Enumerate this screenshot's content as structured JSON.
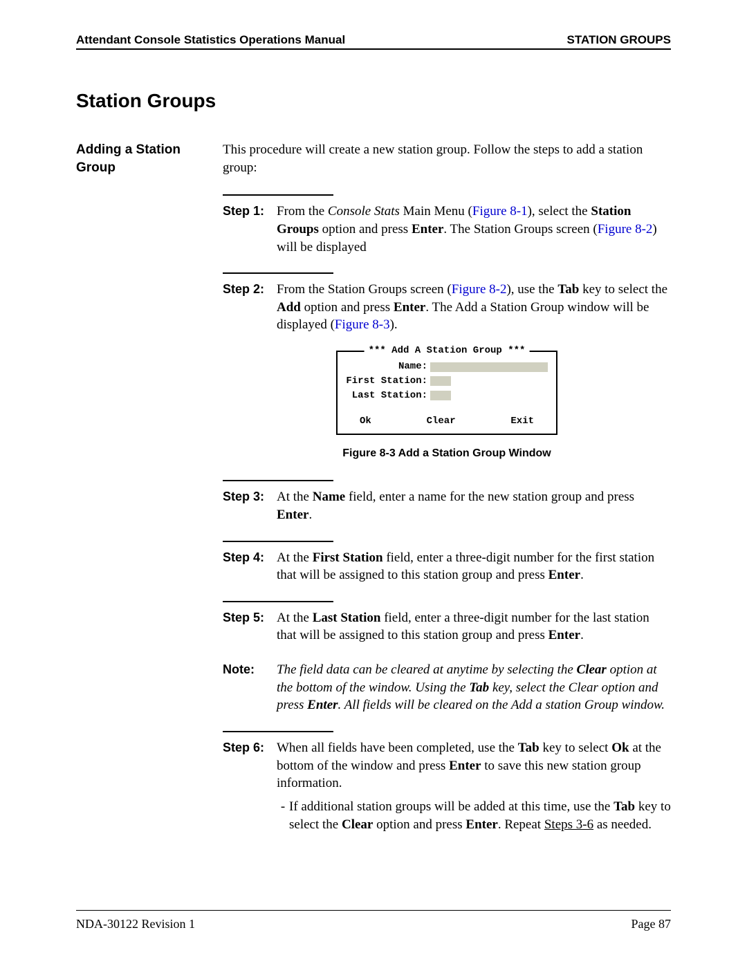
{
  "header": {
    "left": "Attendant Console Statistics Operations Manual",
    "right": "STATION GROUPS"
  },
  "section_title": "Station Groups",
  "side_heading": "Adding a Station Group",
  "intro": {
    "t1": "This procedure will create a new station group. Follow the steps to add a station group:"
  },
  "step1": {
    "label": "Step 1:",
    "t1": "From the ",
    "em1": "Console Stats",
    "t2": " Main Menu (",
    "ref1": "Figure 8-1",
    "t3": "), select the ",
    "b1": "Station Groups",
    "t4": " option and press ",
    "b2": "Enter",
    "t5": ". The Station Groups screen (",
    "ref2": "Figure 8-2",
    "t6": ") will be displayed"
  },
  "step2": {
    "label": "Step 2:",
    "t1": "From the Station Groups screen (",
    "ref1": "Figure 8-2",
    "t2": "), use the ",
    "b1": "Tab",
    "t3": " key to select the ",
    "b2": "Add",
    "t4": " option and press ",
    "b3": "Enter",
    "t5": ". The Add a Station Group window will be displayed (",
    "ref2": "Figure 8-3",
    "t6": ")."
  },
  "dialog": {
    "title_core": " *** Add A Station Group *** ",
    "field_name": "Name:",
    "field_first": "First Station:",
    "field_last": "Last Station:",
    "btn_ok": "Ok",
    "btn_clear": "Clear",
    "btn_exit": "Exit"
  },
  "figure_caption": "Figure 8-3   Add a Station Group Window",
  "step3": {
    "label": "Step 3:",
    "t1": "At the ",
    "b1": "Name",
    "t2": " field, enter a name for the new station group and press ",
    "b2": "Enter",
    "t3": "."
  },
  "step4": {
    "label": "Step 4:",
    "t1": "At the ",
    "b1": "First Station",
    "t2": " field, enter a three-digit number for the first station that will be assigned to this station group and press ",
    "b2": "Enter",
    "t3": "."
  },
  "step5": {
    "label": "Step 5:",
    "t1": "At the ",
    "b1": "Last Station",
    "t2": " field, enter a three-digit number for the last station that will be assigned to this station group and press ",
    "b2": "Enter",
    "t3": "."
  },
  "note": {
    "label": "Note:",
    "t1": "The field data can be cleared at anytime by selecting the ",
    "b1": "Clear",
    "t2": " option at the bottom of the window. Using the ",
    "b2": "Tab",
    "t3": " key, select the Clear option and press ",
    "b3": "Enter",
    "t4": ". All fields will be cleared on the Add a station Group window."
  },
  "step6": {
    "label": "Step 6:",
    "t1": "When all fields have been completed, use the ",
    "b1": "Tab",
    "t2": " key to select ",
    "b2": "Ok",
    "t3": " at the bottom of the window and press ",
    "b3": "Enter",
    "t4": " to save this new station group information.",
    "sub_t1": "If additional station groups will be added at this time, use the ",
    "sub_b1": "Tab",
    "sub_t2": " key to select the ",
    "sub_b2": "Clear",
    "sub_t3": " option and press ",
    "sub_b3": "Enter",
    "sub_t4": ". Repeat ",
    "sub_u1": "Steps 3-6",
    "sub_t5": " as needed."
  },
  "footer": {
    "left": "NDA-30122   Revision 1",
    "right": "Page 87"
  }
}
